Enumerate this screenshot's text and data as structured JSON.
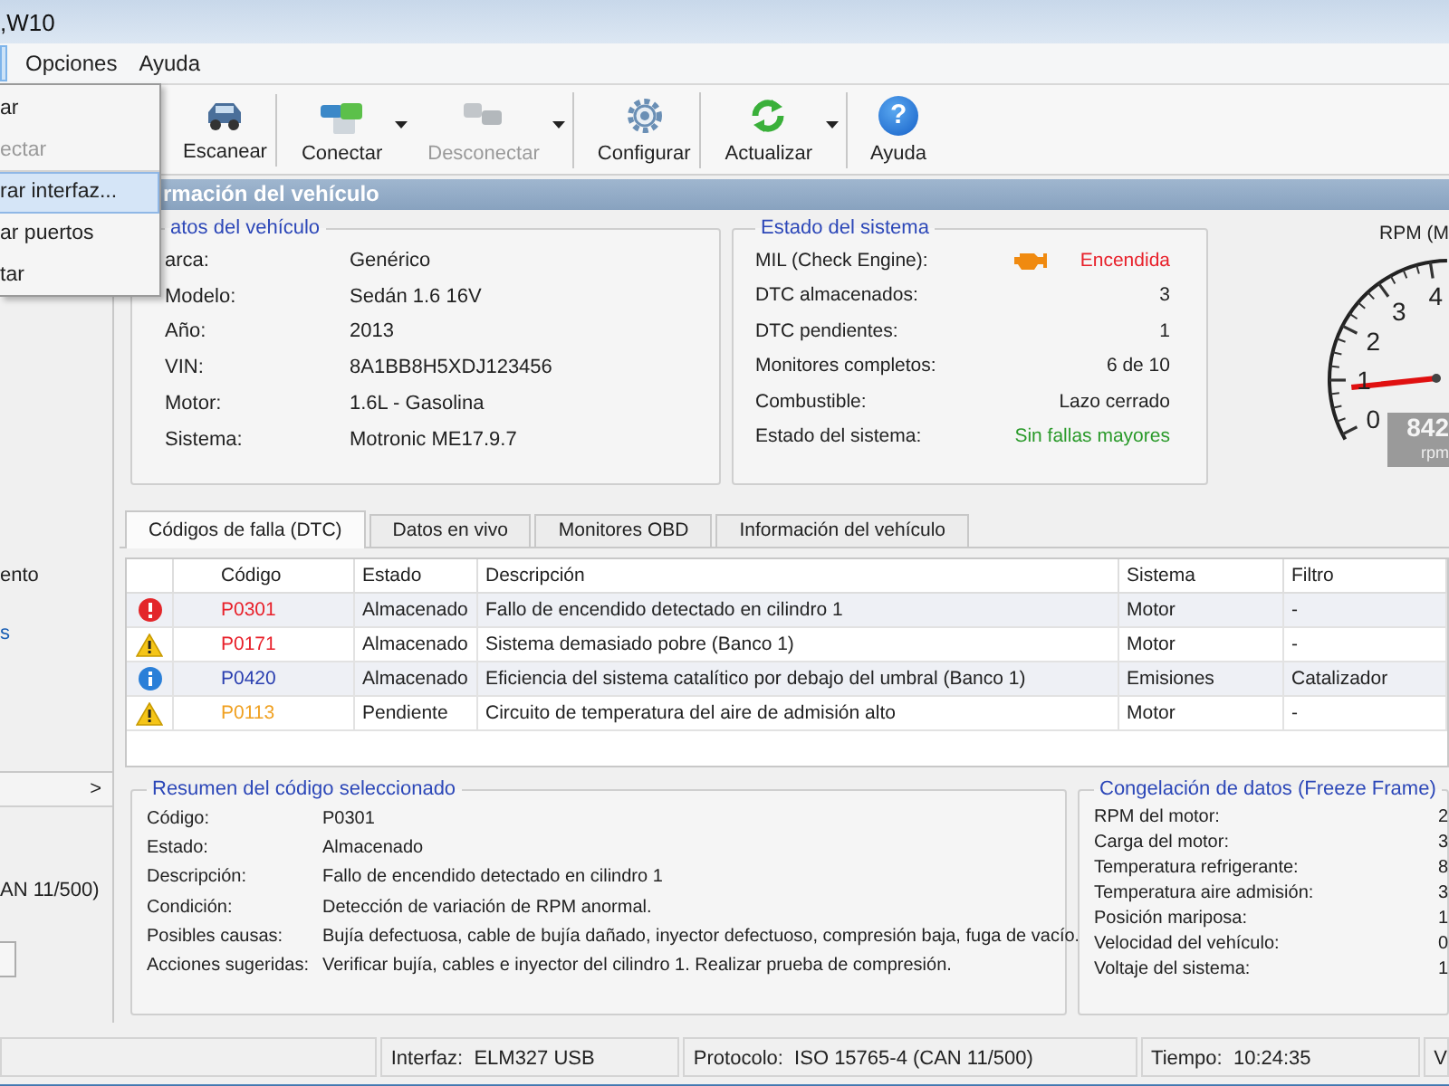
{
  "window": {
    "title": ",W10"
  },
  "menu_bar": [
    {
      "label": "Opciones",
      "selected": false
    },
    {
      "label": "Ayuda",
      "selected": false
    }
  ],
  "open_menu": {
    "items": [
      {
        "label": "ar",
        "disabled": false,
        "selected": false,
        "separator_after": false
      },
      {
        "label": "ectar",
        "disabled": true,
        "selected": false,
        "separator_after": true
      },
      {
        "label": "rar interfaz...",
        "disabled": false,
        "selected": true,
        "separator_after": false
      },
      {
        "label": "ar puertos",
        "disabled": false,
        "selected": false,
        "separator_after": false
      },
      {
        "label": "tar",
        "disabled": false,
        "selected": false,
        "separator_after": false
      }
    ]
  },
  "toolbar": [
    {
      "kind": "scan",
      "label": "Escanear",
      "disabled": false,
      "dropdown": false,
      "separator_after": true
    },
    {
      "kind": "connect",
      "label": "Conectar",
      "disabled": false,
      "dropdown": true,
      "separator_after": false
    },
    {
      "kind": "disconnect",
      "label": "Desconectar",
      "disabled": true,
      "dropdown": true,
      "separator_after": true
    },
    {
      "kind": "settings",
      "label": "Configurar",
      "disabled": false,
      "dropdown": false,
      "separator_after": true
    },
    {
      "kind": "refresh",
      "label": "Actualizar",
      "disabled": false,
      "dropdown": true,
      "separator_after": true
    },
    {
      "kind": "help",
      "label": "Ayuda",
      "disabled": false,
      "dropdown": false,
      "separator_after": false,
      "glyph": "?"
    }
  ],
  "sidebar": {
    "items": [
      {
        "label": "ento",
        "kind": "text"
      },
      {
        "label": "s",
        "kind": "link"
      }
    ],
    "panel": {
      "expander": ">",
      "text": "AN 11/500)"
    }
  },
  "header": "rmación del vehículo",
  "vehicle": {
    "title": "atos del vehículo",
    "rows": [
      {
        "label": "arca:",
        "value": "Genérico"
      },
      {
        "label": "Modelo:",
        "value": "Sedán 1.6 16V"
      },
      {
        "label": "Año:",
        "value": "2013"
      },
      {
        "label": "VIN:",
        "value": "8A1BB8H5XDJ123456"
      },
      {
        "label": "Motor:",
        "value": "1.6L - Gasolina"
      },
      {
        "label": "Sistema:",
        "value": "Motronic ME17.9.7"
      }
    ]
  },
  "system": {
    "title": "Estado del sistema",
    "rows": [
      {
        "label": "MIL (Check Engine):",
        "value": "Encendida",
        "color": "#e8202a",
        "icon": true
      },
      {
        "label": "DTC almacenados:",
        "value": "3",
        "color": "#222222",
        "icon": false
      },
      {
        "label": "DTC pendientes:",
        "value": "1",
        "color": "#222222",
        "icon": false
      },
      {
        "label": "Monitores completos:",
        "value": "6 de 10",
        "color": "#222222",
        "icon": false
      },
      {
        "label": "Combustible:",
        "value": "Lazo cerrado",
        "color": "#222222",
        "icon": false
      },
      {
        "label": "Estado del sistema:",
        "value": "Sin fallas mayores",
        "color": "#2a9a2a",
        "icon": false
      }
    ]
  },
  "gauge": {
    "title": "RPM (M",
    "ticks": [
      "0",
      "1",
      "2",
      "3",
      "4"
    ],
    "reading": "842",
    "unit": "rpm"
  },
  "tabs": [
    {
      "label": "Códigos de falla (DTC)",
      "selected": true
    },
    {
      "label": "Datos en vivo",
      "selected": false
    },
    {
      "label": "Monitores OBD",
      "selected": false
    },
    {
      "label": "Información del vehículo",
      "selected": false
    }
  ],
  "table": {
    "columns": [
      "Código",
      "Estado",
      "Descripción",
      "Sistema",
      "Filtro"
    ],
    "rows": [
      {
        "kind": "error",
        "color": "#e8202a",
        "code": "P0301",
        "status": "Almacenado",
        "description": "Fallo de encendido detectado en cilindro 1",
        "system": "Motor",
        "filter": "-"
      },
      {
        "kind": "warning",
        "color": "#e8202a",
        "code": "P0171",
        "status": "Almacenado",
        "description": "Sistema demasiado pobre (Banco 1)",
        "system": "Motor",
        "filter": "-"
      },
      {
        "kind": "info",
        "color": "#2a3fb0",
        "code": "P0420",
        "status": "Almacenado",
        "description": "Eficiencia del sistema catalítico por debajo del umbral (Banco 1)",
        "system": "Emisiones",
        "filter": "Catalizador"
      },
      {
        "kind": "warning",
        "color": "#f0a020",
        "code": "P0113",
        "status": "Pendiente",
        "description": "Circuito de temperatura del aire de admisión alto",
        "system": "Motor",
        "filter": "-"
      }
    ]
  },
  "summary": {
    "title": "Resumen del código seleccionado",
    "rows": [
      {
        "label": "Código:",
        "value": "P0301"
      },
      {
        "label": "Estado:",
        "value": "Almacenado"
      },
      {
        "label": "Descripción:",
        "value": "Fallo de encendido detectado en cilindro 1"
      },
      {
        "label": "Condición:",
        "value": "Detección de variación de RPM anormal."
      },
      {
        "label": "Posibles causas:",
        "value": "Bujía defectuosa, cable de bujía dañado, inyector defectuoso, compresión baja, fuga de vacío."
      },
      {
        "label": "Acciones sugeridas:",
        "value": "Verificar bujía, cables e inyector del cilindro 1. Realizar prueba de compresión."
      }
    ]
  },
  "freeze_frame": {
    "title": "Congelación de datos (Freeze Frame)",
    "rows": [
      {
        "label": "RPM del motor:",
        "value": "2"
      },
      {
        "label": "Carga del motor:",
        "value": "3"
      },
      {
        "label": "Temperatura refrigerante:",
        "value": "8"
      },
      {
        "label": "Temperatura aire admisión:",
        "value": "3"
      },
      {
        "label": "Posición mariposa:",
        "value": "1"
      },
      {
        "label": "Velocidad del vehículo:",
        "value": "0"
      },
      {
        "label": "Voltaje del sistema:",
        "value": "1"
      }
    ]
  },
  "status_bar": [
    "Interfaz:  ELM327 USB",
    "Protocolo:  ISO 15765-4 (CAN 11/500)",
    "Tiempo:  10:24:35",
    "V"
  ]
}
